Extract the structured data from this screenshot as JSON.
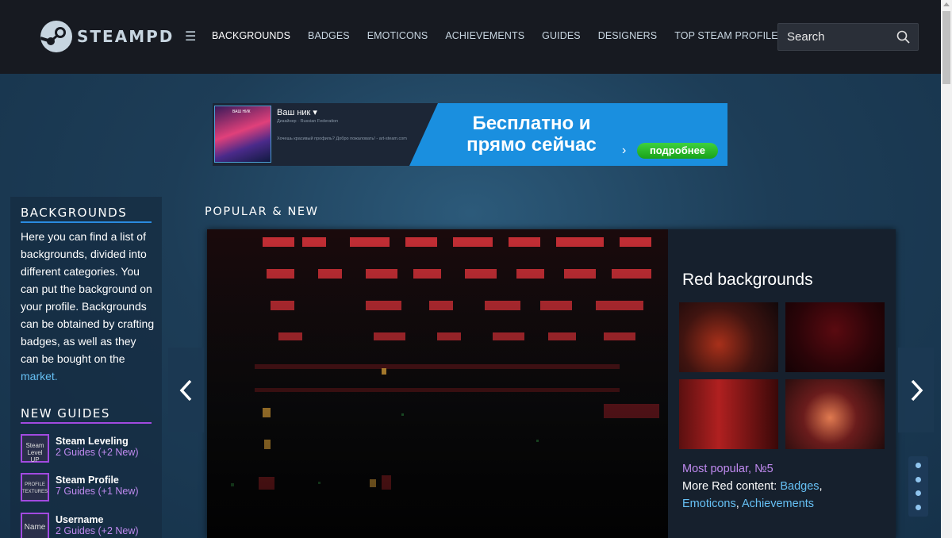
{
  "header": {
    "logo_text": "STEAMPD",
    "nav": [
      {
        "label": "BACKGROUNDS",
        "active": true
      },
      {
        "label": "BADGES",
        "active": false
      },
      {
        "label": "EMOTICONS",
        "active": false
      },
      {
        "label": "ACHIEVEMENTS",
        "active": false
      },
      {
        "label": "GUIDES",
        "active": false
      },
      {
        "label": "DESIGNERS",
        "active": false
      },
      {
        "label": "TOP STEAM PROFILES",
        "active": false
      }
    ],
    "search_placeholder": "Search"
  },
  "banner": {
    "avatar_tag": "ВАШ НИК",
    "name": "Ваш ник ▾",
    "subtitle": "Дизайнер · Russian Federation",
    "small_text": "Хочешь красивый профиль? Добро пожаловать! - art-steam.com",
    "headline_1": "Бесплатно и",
    "headline_2": "прямо сейчас",
    "button": "подробнее"
  },
  "sidebar": {
    "title": "BACKGROUNDS",
    "description": "Here you can find a list of backgrounds, divided into different categories. You can put the background on your profile. Backgrounds can be obtained by crafting badges, as well as they can be bought on the",
    "market_link": "market.",
    "guides_title": "NEW GUIDES",
    "guides": [
      {
        "thumb": "Steam Level UP",
        "title": "Steam Leveling",
        "sub": "2 Guides (+2 New)"
      },
      {
        "thumb": "PROFILE TEXTURES",
        "title": "Steam Profile",
        "sub": "7 Guides (+1 New)"
      },
      {
        "thumb": "Name",
        "title": "Username",
        "sub": "2 Guides (+2 New)"
      }
    ]
  },
  "main": {
    "section_title": "POPULAR & NEW",
    "panel_title": "Red backgrounds",
    "popular": "Most popular, №5",
    "more_prefix": "More Red content: ",
    "link_badges": "Badges",
    "comma": ",",
    "link_emoticons": "Emoticons",
    "link_achievements": "Achievements",
    "dots": 4
  },
  "colors": {
    "accent_blue": "#66c0f4",
    "accent_purple": "#c08af0",
    "header_bg": "#171a21"
  }
}
